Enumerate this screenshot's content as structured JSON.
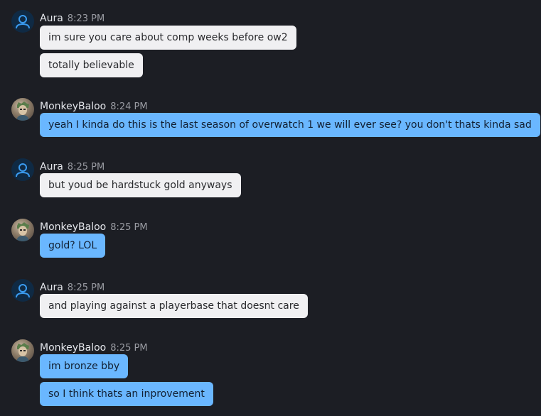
{
  "colors": {
    "background": "#1c1e24",
    "incoming_bubble": "#f0f0f2",
    "outgoing_bubble": "#6ab7ff",
    "default_avatar_accent": "#3a9bf0"
  },
  "messages": [
    {
      "author": "Aura",
      "time": "8:23 PM",
      "avatar": "default-user-icon",
      "lines": [
        "im sure you care about comp weeks before ow2",
        "totally believable"
      ]
    },
    {
      "author": "MonkeyBaloo",
      "time": "8:24 PM",
      "avatar": "profile-photo",
      "lines": [
        "yeah I kinda do this is the last season of overwatch 1 we will ever see? you don't thats kinda sad"
      ]
    },
    {
      "author": "Aura",
      "time": "8:25 PM",
      "avatar": "default-user-icon",
      "lines": [
        "but youd be hardstuck gold anyways"
      ]
    },
    {
      "author": "MonkeyBaloo",
      "time": "8:25 PM",
      "avatar": "profile-photo",
      "lines": [
        "gold? LOL"
      ]
    },
    {
      "author": "Aura",
      "time": "8:25 PM",
      "avatar": "default-user-icon",
      "lines": [
        "and playing against a playerbase that doesnt care"
      ]
    },
    {
      "author": "MonkeyBaloo",
      "time": "8:25 PM",
      "avatar": "profile-photo",
      "lines": [
        "im bronze bby",
        "so I think thats an inprovement"
      ]
    }
  ]
}
